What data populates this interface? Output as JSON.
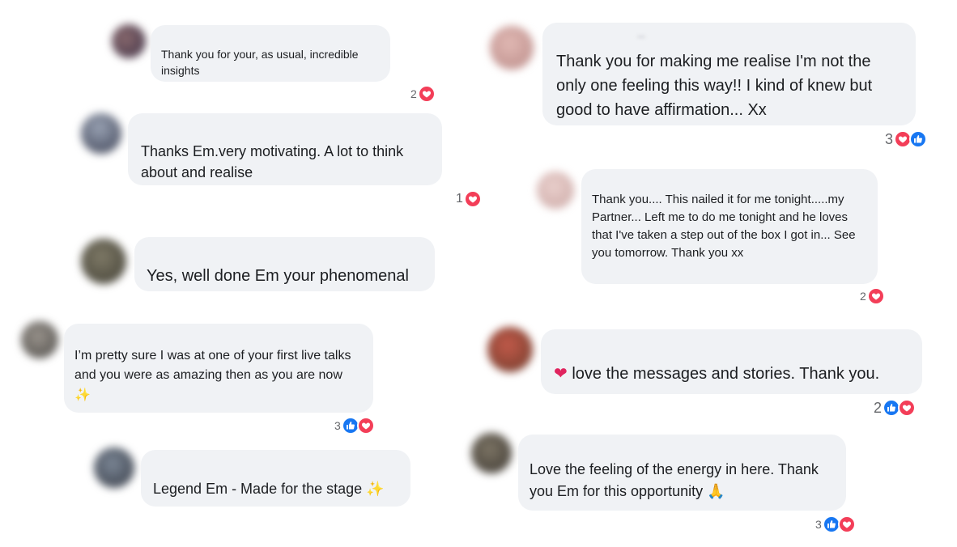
{
  "colors": {
    "bubble": "#f0f2f5",
    "heart": "#f33e58",
    "like": "#1877f2",
    "text": "#1c1e21",
    "count": "#65676b"
  },
  "comments": [
    {
      "text": "Thank you for your, as usual, incredible insights",
      "reaction_count": "2",
      "reactions": [
        "heart-icon"
      ]
    },
    {
      "text": "Thanks Em.very motivating. A lot to think about and realise",
      "reaction_count": "1",
      "reactions": [
        "heart-icon"
      ]
    },
    {
      "text": "Yes, well done Em your phenomenal",
      "reaction_count": "",
      "reactions": []
    },
    {
      "text": "I’m pretty sure I was at one of your first live talks and you were as amazing then as you are now",
      "emoji": "✨",
      "reaction_count": "3",
      "reactions": [
        "like-icon",
        "heart-icon"
      ]
    },
    {
      "text": "Legend Em - Made for the stage",
      "emoji": "✨",
      "reaction_count": "",
      "reactions": []
    },
    {
      "text": "Thank you for making me realise I'm not the only one feeling this way!! I kind of knew but good to have affirmation... Xx",
      "reaction_count": "3",
      "reactions": [
        "heart-icon",
        "like-icon"
      ]
    },
    {
      "text": "Thank you.... This nailed it for me tonight.....my Partner... Left me to do me tonight and he loves that I've taken a step out of the box I got in... See you tomorrow. Thank you xx",
      "reaction_count": "2",
      "reactions": [
        "heart-icon"
      ]
    },
    {
      "emoji_prefix": "❤",
      "text": "love the messages and stories.  Thank you.",
      "reaction_count": "2",
      "reactions": [
        "like-icon",
        "heart-icon"
      ]
    },
    {
      "text": "Love the feeling of the energy in here. Thank you Em for this opportunity",
      "emoji": "🙏",
      "reaction_count": "3",
      "reactions": [
        "like-icon",
        "heart-icon"
      ]
    }
  ]
}
